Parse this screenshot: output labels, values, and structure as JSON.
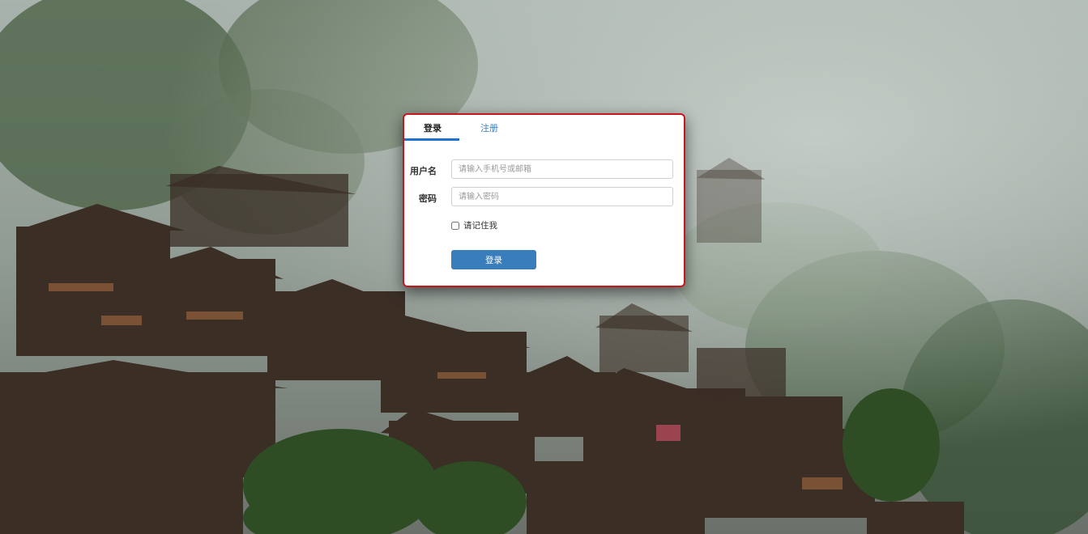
{
  "tabs": [
    {
      "label": "登录"
    },
    {
      "label": "注册"
    }
  ],
  "form": {
    "username_label": "用户名",
    "username_placeholder": "请输入手机号或邮箱",
    "password_label": "密码",
    "password_placeholder": "请输入密码",
    "remember_label": "请记住我",
    "submit_label": "登录"
  },
  "colors": {
    "accent": "#1e73d2",
    "button": "#3a7dbd",
    "panel_border": "#c9151e"
  },
  "background": {
    "description_icon": "misty-village-photo"
  }
}
